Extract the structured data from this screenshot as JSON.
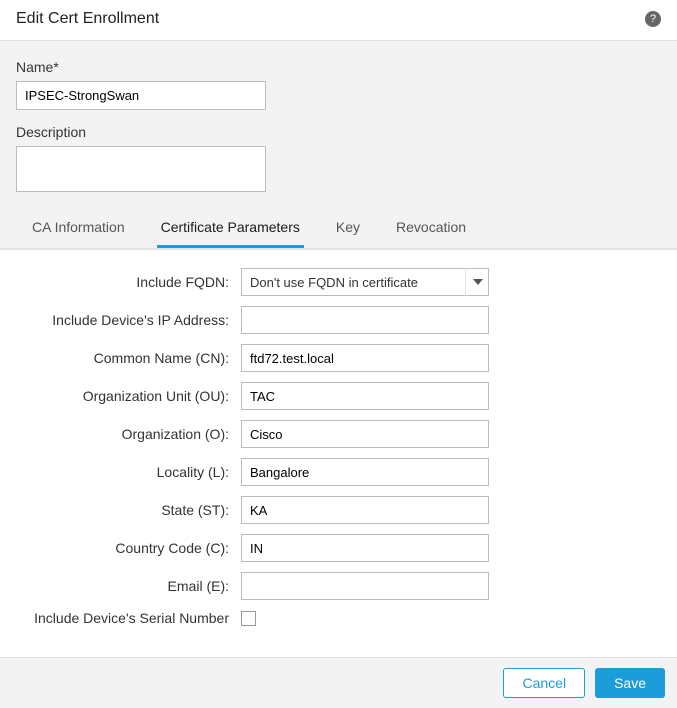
{
  "dialog": {
    "title": "Edit Cert Enrollment",
    "helpTooltip": "?"
  },
  "upper": {
    "nameLabel": "Name*",
    "nameValue": "IPSEC-StrongSwan",
    "descriptionLabel": "Description",
    "descriptionValue": ""
  },
  "tabs": [
    {
      "label": "CA Information",
      "active": false
    },
    {
      "label": "Certificate Parameters",
      "active": true
    },
    {
      "label": "Key",
      "active": false
    },
    {
      "label": "Revocation",
      "active": false
    }
  ],
  "form": {
    "includeFqdn": {
      "label": "Include FQDN:",
      "value": "Don't use FQDN in certificate"
    },
    "includeIp": {
      "label": "Include Device's IP Address:",
      "value": ""
    },
    "commonName": {
      "label": "Common Name (CN):",
      "value": "ftd72.test.local"
    },
    "orgUnit": {
      "label": "Organization Unit (OU):",
      "value": "TAC"
    },
    "org": {
      "label": "Organization (O):",
      "value": "Cisco"
    },
    "locality": {
      "label": "Locality (L):",
      "value": "Bangalore"
    },
    "state": {
      "label": "State (ST):",
      "value": "KA"
    },
    "country": {
      "label": "Country Code (C):",
      "value": "IN"
    },
    "email": {
      "label": "Email (E):",
      "value": ""
    },
    "serial": {
      "label": "Include Device's Serial Number",
      "checked": false
    }
  },
  "footer": {
    "cancel": "Cancel",
    "save": "Save"
  }
}
